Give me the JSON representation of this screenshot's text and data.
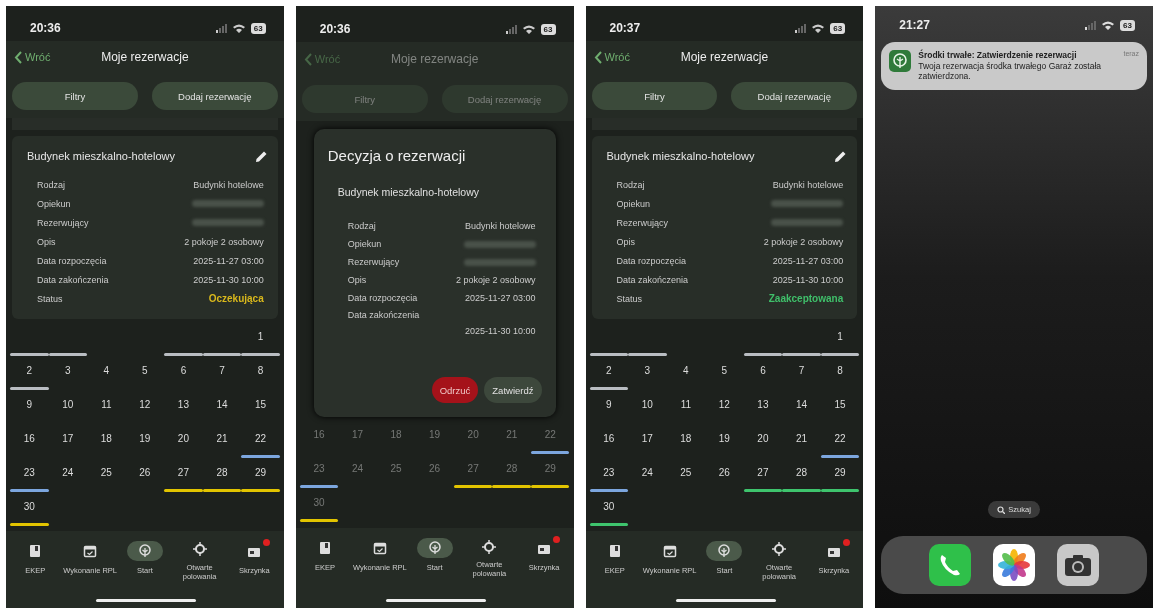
{
  "screens": [
    {
      "kind": "app",
      "dimmed": false,
      "status_bar": {
        "time": "20:36",
        "battery": "63"
      },
      "header": {
        "back": "Wróć",
        "title": "Moje rezerwacje"
      },
      "actions": [
        "Filtry",
        "Dodaj rezerwację"
      ],
      "card": {
        "title": "Budynek mieszkalno-hotelowy",
        "rows": [
          {
            "kind": "text",
            "label": "Rodzaj",
            "value": "Budynki hotelowe"
          },
          {
            "kind": "redacted",
            "label": "Opiekun"
          },
          {
            "kind": "redacted",
            "label": "Rezerwujący"
          },
          {
            "kind": "text",
            "label": "Opis",
            "value": "2 pokoje 2 osobowy"
          },
          {
            "kind": "text",
            "label": "Data rozpoczęcia",
            "value": "2025-11-27 03:00"
          },
          {
            "kind": "text",
            "label": "Data zakończenia",
            "value": "2025-11-30 10:00"
          },
          {
            "kind": "status",
            "label": "Status",
            "value": "Oczekująca",
            "color": "#d9b81c"
          }
        ]
      },
      "calendar": {
        "weeks": [
          {
            "cells": [
              {
                "color": "#b9bdc2"
              },
              {
                "color": "#b9bdc2"
              },
              {},
              {},
              {
                "color": "#b9bdc2"
              },
              {
                "color": "#b9bdc2"
              },
              {
                "day": "1",
                "color": "#b9bdc2"
              }
            ]
          },
          {
            "cells": [
              {
                "day": "2",
                "color": "#b9bdc2"
              },
              {
                "day": "3"
              },
              {
                "day": "4"
              },
              {
                "day": "5"
              },
              {
                "day": "6"
              },
              {
                "day": "7"
              },
              {
                "day": "8"
              }
            ]
          },
          {
            "cells": [
              {
                "day": "9"
              },
              {
                "day": "10"
              },
              {
                "day": "11"
              },
              {
                "day": "12"
              },
              {
                "day": "13"
              },
              {
                "day": "14"
              },
              {
                "day": "15"
              }
            ]
          },
          {
            "cells": [
              {
                "day": "16"
              },
              {
                "day": "17"
              },
              {
                "day": "18"
              },
              {
                "day": "19"
              },
              {
                "day": "20"
              },
              {
                "day": "21"
              },
              {
                "day": "22",
                "color": "#7ca6de"
              }
            ]
          },
          {
            "cells": [
              {
                "day": "23",
                "color": "#7ca6de"
              },
              {
                "day": "24"
              },
              {
                "day": "25"
              },
              {
                "day": "26"
              },
              {
                "day": "27",
                "color": "#e2c400"
              },
              {
                "day": "28",
                "color": "#e2c400"
              },
              {
                "day": "29",
                "color": "#e2c400"
              }
            ]
          },
          {
            "cells": [
              {
                "day": "30",
                "color": "#e2c400"
              },
              {},
              {},
              {},
              {},
              {},
              {}
            ]
          }
        ]
      },
      "tab_bar": [
        {
          "label": "EKEP",
          "selected": false,
          "badge": false
        },
        {
          "label": "Wykonanie RPL",
          "selected": false,
          "badge": false
        },
        {
          "label": "Start",
          "selected": true,
          "badge": false
        },
        {
          "label": "Otwarte polowania",
          "selected": false,
          "badge": false
        },
        {
          "label": "Skrzynka",
          "selected": false,
          "badge": true
        }
      ]
    },
    {
      "kind": "app",
      "dimmed": true,
      "status_bar": {
        "time": "20:36",
        "battery": "63"
      },
      "header": {
        "back": "Wróć",
        "title": "Moje rezerwacje"
      },
      "actions": [
        "Filtry",
        "Dodaj rezerwację"
      ],
      "dialog": {
        "title": "Decyzja o rezerwacji",
        "subtitle": "Budynek mieszkalno-hotelowy",
        "rows": [
          {
            "kind": "text",
            "label": "Rodzaj",
            "value": "Budynki hotelowe"
          },
          {
            "kind": "redacted",
            "label": "Opiekun"
          },
          {
            "kind": "redacted",
            "label": "Rezerwujący"
          },
          {
            "kind": "text",
            "label": "Opis",
            "value": "2 pokoje 2 osobowy"
          },
          {
            "kind": "text",
            "label": "Data rozpoczęcia",
            "value": "2025-11-27 03:00"
          },
          {
            "kind": "text",
            "label": "Data zakończenia",
            "value": "2025-11-30 10:00"
          }
        ],
        "reject": "Odrzuć",
        "approve": "Zatwierdź"
      },
      "calendar": {
        "weeks": [
          {
            "cells": [
              {
                "day": "16"
              },
              {
                "day": "17"
              },
              {
                "day": "18"
              },
              {
                "day": "19"
              },
              {
                "day": "20"
              },
              {
                "day": "21"
              },
              {
                "day": "22",
                "color": "#7ca6de"
              }
            ]
          },
          {
            "cells": [
              {
                "day": "23",
                "color": "#7ca6de"
              },
              {
                "day": "24"
              },
              {
                "day": "25"
              },
              {
                "day": "26"
              },
              {
                "day": "27",
                "color": "#e2c400"
              },
              {
                "day": "28",
                "color": "#e2c400"
              },
              {
                "day": "29",
                "color": "#e2c400"
              }
            ]
          },
          {
            "cells": [
              {
                "day": "30",
                "color": "#e2c400"
              },
              {},
              {},
              {},
              {},
              {},
              {}
            ]
          }
        ]
      },
      "tab_bar": [
        {
          "label": "EKEP",
          "selected": false,
          "badge": false
        },
        {
          "label": "Wykonanie RPL",
          "selected": false,
          "badge": false
        },
        {
          "label": "Start",
          "selected": true,
          "badge": false
        },
        {
          "label": "Otwarte polowania",
          "selected": false,
          "badge": false
        },
        {
          "label": "Skrzynka",
          "selected": false,
          "badge": true
        }
      ]
    },
    {
      "kind": "app",
      "dimmed": false,
      "status_bar": {
        "time": "20:37",
        "battery": "63"
      },
      "header": {
        "back": "Wróć",
        "title": "Moje rezerwacje"
      },
      "actions": [
        "Filtry",
        "Dodaj rezerwację"
      ],
      "card": {
        "title": "Budynek mieszkalno-hotelowy",
        "rows": [
          {
            "kind": "text",
            "label": "Rodzaj",
            "value": "Budynki hotelowe"
          },
          {
            "kind": "redacted",
            "label": "Opiekun"
          },
          {
            "kind": "redacted",
            "label": "Rezerwujący"
          },
          {
            "kind": "text",
            "label": "Opis",
            "value": "2 pokoje 2 osobowy"
          },
          {
            "kind": "text",
            "label": "Data rozpoczęcia",
            "value": "2025-11-27 03:00"
          },
          {
            "kind": "text",
            "label": "Data zakończenia",
            "value": "2025-11-30 10:00"
          },
          {
            "kind": "status",
            "label": "Status",
            "value": "Zaakceptowana",
            "color": "#3fbf6a"
          }
        ]
      },
      "calendar": {
        "weeks": [
          {
            "cells": [
              {
                "color": "#b9bdc2"
              },
              {
                "color": "#b9bdc2"
              },
              {},
              {},
              {
                "color": "#b9bdc2"
              },
              {
                "color": "#b9bdc2"
              },
              {
                "day": "1",
                "color": "#b9bdc2"
              }
            ]
          },
          {
            "cells": [
              {
                "day": "2",
                "color": "#b9bdc2"
              },
              {
                "day": "3"
              },
              {
                "day": "4"
              },
              {
                "day": "5"
              },
              {
                "day": "6"
              },
              {
                "day": "7"
              },
              {
                "day": "8"
              }
            ]
          },
          {
            "cells": [
              {
                "day": "9"
              },
              {
                "day": "10"
              },
              {
                "day": "11"
              },
              {
                "day": "12"
              },
              {
                "day": "13"
              },
              {
                "day": "14"
              },
              {
                "day": "15"
              }
            ]
          },
          {
            "cells": [
              {
                "day": "16"
              },
              {
                "day": "17"
              },
              {
                "day": "18"
              },
              {
                "day": "19"
              },
              {
                "day": "20"
              },
              {
                "day": "21"
              },
              {
                "day": "22",
                "color": "#7ca6de"
              }
            ]
          },
          {
            "cells": [
              {
                "day": "23",
                "color": "#7ca6de"
              },
              {
                "day": "24"
              },
              {
                "day": "25"
              },
              {
                "day": "26"
              },
              {
                "day": "27",
                "color": "#3ec46d"
              },
              {
                "day": "28",
                "color": "#3ec46d"
              },
              {
                "day": "29",
                "color": "#3ec46d"
              }
            ]
          },
          {
            "cells": [
              {
                "day": "30",
                "color": "#3ec46d"
              },
              {},
              {},
              {},
              {},
              {},
              {}
            ]
          }
        ]
      },
      "tab_bar": [
        {
          "label": "EKEP",
          "selected": false,
          "badge": false
        },
        {
          "label": "Wykonanie RPL",
          "selected": false,
          "badge": false
        },
        {
          "label": "Start",
          "selected": true,
          "badge": false
        },
        {
          "label": "Otwarte polowania",
          "selected": false,
          "badge": false
        },
        {
          "label": "Skrzynka",
          "selected": false,
          "badge": true
        }
      ]
    },
    {
      "kind": "home",
      "status_bar": {
        "time": "21:27",
        "battery": "63"
      },
      "notification": {
        "title": "Środki trwałe: Zatwierdzenie rezerwacji",
        "time": "teraz",
        "body": "Twoja rezerwacja środka trwałego Garaż została zatwierdzona."
      },
      "search": "Szukaj"
    }
  ]
}
